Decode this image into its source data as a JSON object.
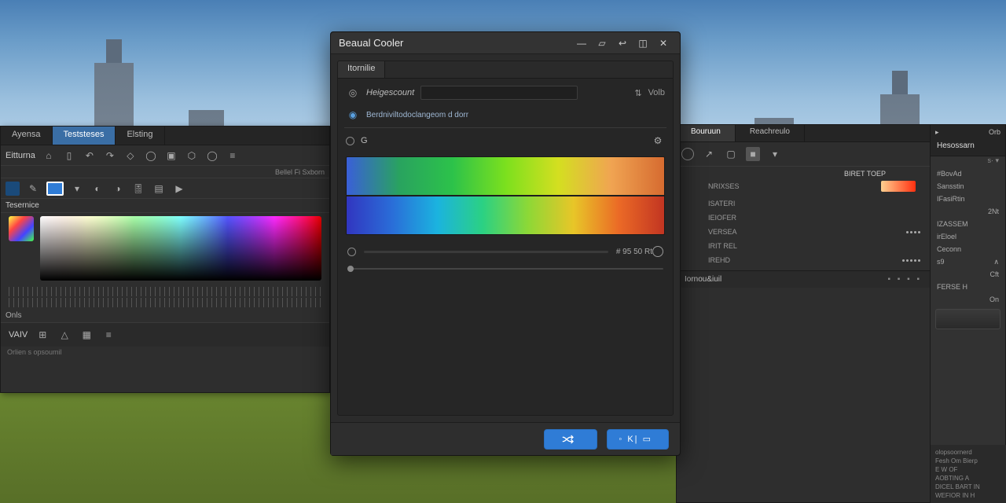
{
  "modal": {
    "title": "Beaual Cooler",
    "tab_label": "Itornilie",
    "field1_label": "Heigescount",
    "filter_label": "Volb",
    "field2_label": "Berdniviltodoclangeom d dorr",
    "channel_label": "G",
    "range_readout": "# 95 50 Rt",
    "ok_label": "",
    "apply_label": ""
  },
  "left_panel": {
    "tabs": [
      "Ayensa",
      "Teststeses",
      "Elsting"
    ],
    "section1": "Eitturna",
    "hint_right": "Bellel Fi Sxborn",
    "section2": "Tesernice",
    "footer_mode": "VAIV",
    "status": "Orlien s opsoumil"
  },
  "right_panel": {
    "tabs": [
      "Bouruun",
      "Reachreulo"
    ],
    "group_header": "BIRET TOEP",
    "items": [
      "NRIXSES",
      "ISATERI",
      "IEIOFER",
      "VERSEA",
      "IRIT REL",
      "IREHD"
    ],
    "footer_left": "Iornou&iuil",
    "side_header": "Hesossarn",
    "side_tab": "Orb",
    "side_rows": [
      {
        "k": "#BovAd",
        "v": ""
      },
      {
        "k": "Sansstin",
        "v": ""
      },
      {
        "k": "IFasiRtin",
        "v": ""
      },
      {
        "k": "",
        "v": "2Nt"
      },
      {
        "k": "IZASSEM",
        "v": ""
      },
      {
        "k": "irEloel",
        "v": ""
      },
      {
        "k": "Ceconn",
        "v": ""
      },
      {
        "k": "s9",
        "v": "∧"
      },
      {
        "k": "",
        "v": "Cft"
      },
      {
        "k": "FERSE H",
        "v": ""
      },
      {
        "k": "",
        "v": "On"
      }
    ],
    "console": [
      "olopsoornerd",
      "Fesh Om Bierp",
      "E  W   OF",
      "AOBTING  A",
      "DICEL BART IN",
      "WEFIOR IN H"
    ]
  }
}
